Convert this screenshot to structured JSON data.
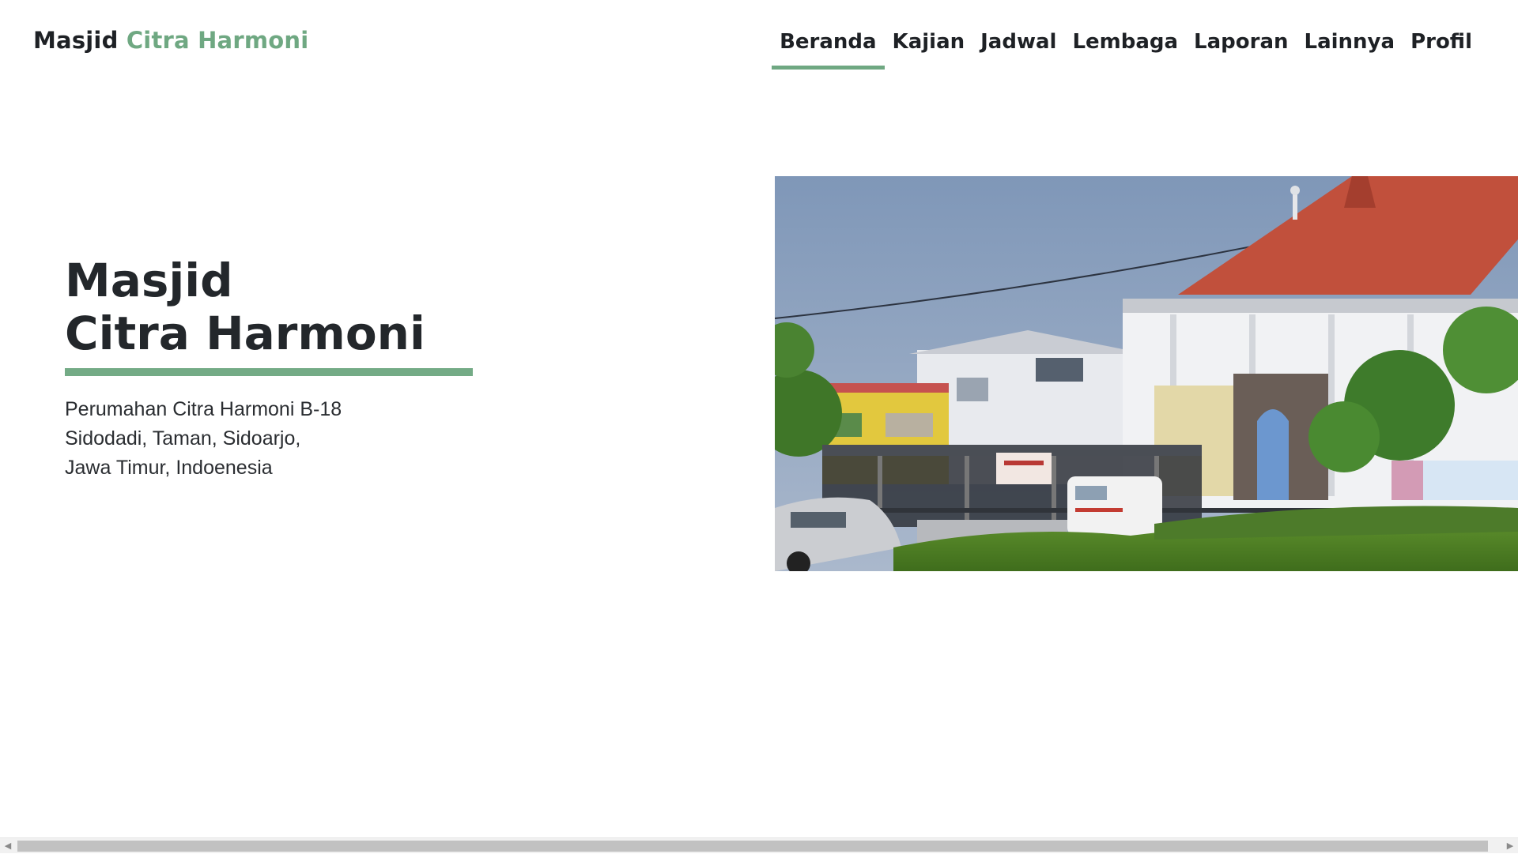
{
  "brand": {
    "main": "Masjid",
    "accent": "Citra Harmoni"
  },
  "nav": {
    "items": [
      {
        "label": "Beranda",
        "active": true
      },
      {
        "label": "Kajian"
      },
      {
        "label": "Jadwal"
      },
      {
        "label": "Lembaga"
      },
      {
        "label": "Laporan"
      },
      {
        "label": "Lainnya"
      },
      {
        "label": "Profil"
      }
    ]
  },
  "hero": {
    "title_line1": "Masjid",
    "title_line2": "Citra Harmoni",
    "address_line1": "Perumahan Citra Harmoni B-18",
    "address_line2": "Sidodadi, Taman, Sidoarjo,",
    "address_line3": "Jawa Timur, Indoenesia"
  },
  "colors": {
    "accent": "#6fa882",
    "text": "#212529",
    "scrollbar_thumb": "#c1c1c1"
  },
  "icons": {
    "scroll_left": "scroll-left-arrow-icon",
    "scroll_right": "scroll-right-arrow-icon",
    "scroll_left_glyph": "◀",
    "scroll_right_glyph": "▶"
  }
}
